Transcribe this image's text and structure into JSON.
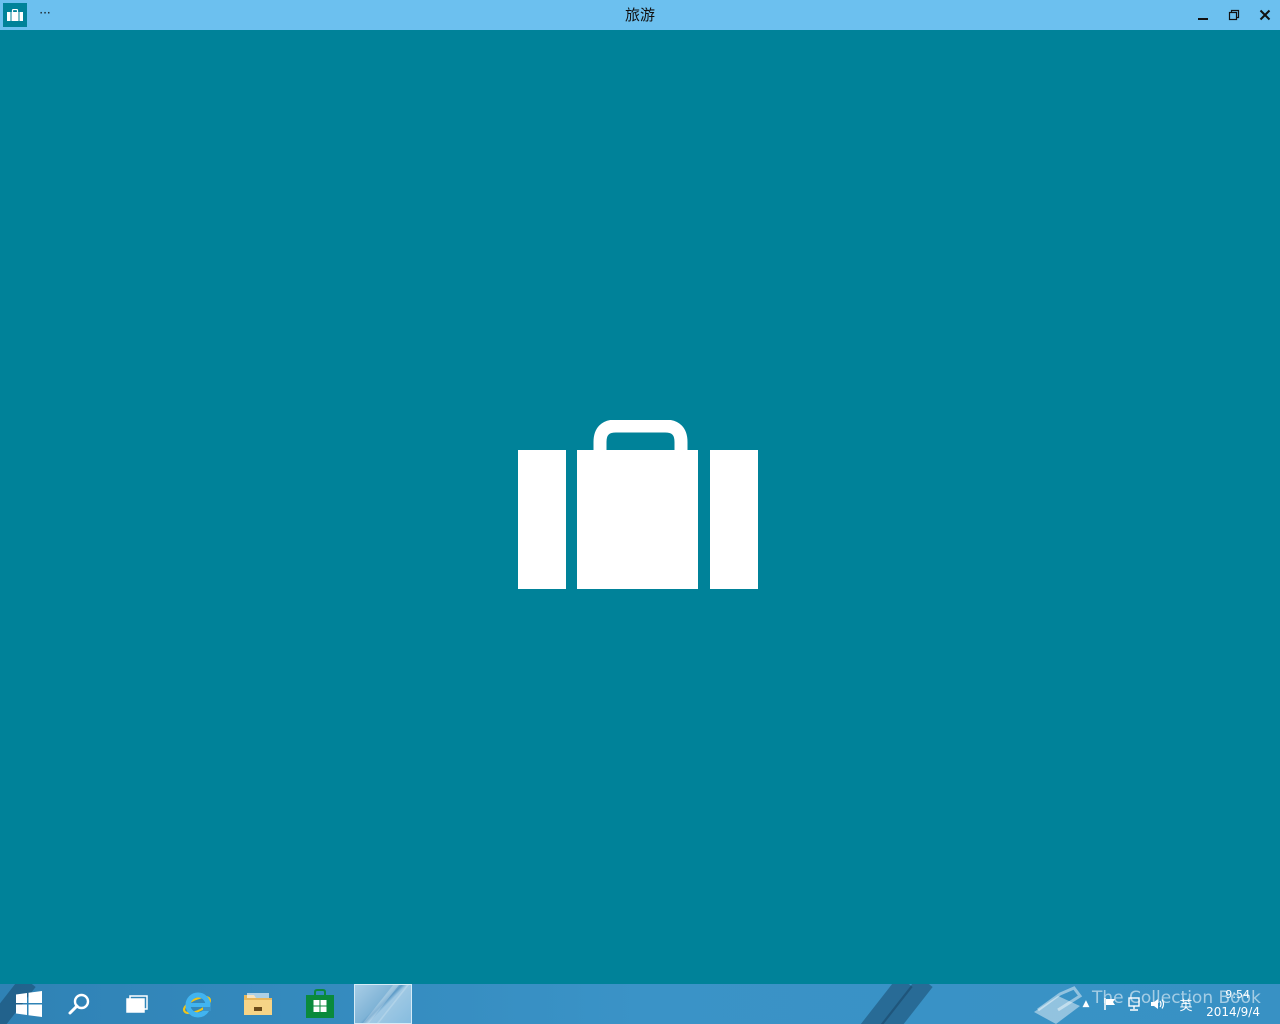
{
  "window": {
    "title": "旅游",
    "menu_label": "···",
    "icon": "suitcase-icon",
    "controls": {
      "minimize": "minimize-icon",
      "restore": "restore-icon",
      "close": "close-icon"
    }
  },
  "splash": {
    "icon": "suitcase-icon",
    "background": "#008299"
  },
  "taskbar": {
    "items": [
      {
        "name": "start-button",
        "icon": "windows-logo-icon"
      },
      {
        "name": "search-button",
        "icon": "search-icon"
      },
      {
        "name": "task-view-button",
        "icon": "task-view-icon"
      },
      {
        "name": "internet-explorer-button",
        "icon": "internet-explorer-icon"
      },
      {
        "name": "file-explorer-button",
        "icon": "folder-icon"
      },
      {
        "name": "store-button",
        "icon": "store-icon"
      },
      {
        "name": "travel-app-button",
        "icon": "app-thumbnail",
        "active": true
      }
    ],
    "tray": {
      "show_hidden_label": "▲",
      "ime_label": "英",
      "time": "9:54",
      "date": "2014/9/4"
    },
    "watermark": "The Collection Book"
  },
  "colors": {
    "titlebar": "#6cc0ef",
    "app_background": "#008299",
    "taskbar": "#3a93c7"
  }
}
